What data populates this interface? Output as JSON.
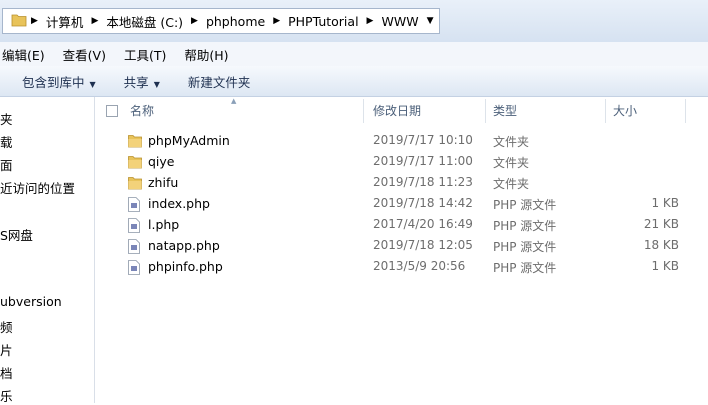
{
  "breadcrumb": [
    "计算机",
    "本地磁盘 (C:)",
    "phphome",
    "PHPTutorial",
    "WWW"
  ],
  "menu": [
    "编辑(E)",
    "查看(V)",
    "工具(T)",
    "帮助(H)"
  ],
  "toolbar": {
    "include_library": "包含到库中",
    "share": "共享",
    "new_folder": "新建文件夹"
  },
  "nav": [
    "夹",
    "载",
    "面",
    "近访问的位置",
    "S网盘",
    "ubversion",
    "频",
    "片",
    "档",
    "乐"
  ],
  "columns": {
    "name": "名称",
    "modified": "修改日期",
    "type": "类型",
    "size": "大小"
  },
  "files": [
    {
      "icon": "folder-icon",
      "name": "phpMyAdmin",
      "date": "2019/7/17 10:10",
      "type": "文件夹",
      "size": ""
    },
    {
      "icon": "folder-icon",
      "name": "qiye",
      "date": "2019/7/17 11:00",
      "type": "文件夹",
      "size": ""
    },
    {
      "icon": "folder-icon",
      "name": "zhifu",
      "date": "2019/7/18 11:23",
      "type": "文件夹",
      "size": ""
    },
    {
      "icon": "php-file-icon",
      "name": "index.php",
      "date": "2019/7/18 14:42",
      "type": "PHP 源文件",
      "size": "1 KB"
    },
    {
      "icon": "php-file-icon",
      "name": "l.php",
      "date": "2017/4/20 16:49",
      "type": "PHP 源文件",
      "size": "21 KB"
    },
    {
      "icon": "php-file-icon",
      "name": "natapp.php",
      "date": "2019/7/18 12:05",
      "type": "PHP 源文件",
      "size": "18 KB"
    },
    {
      "icon": "php-file-icon",
      "name": "phpinfo.php",
      "date": "2013/5/9 20:56",
      "type": "PHP 源文件",
      "size": "1 KB"
    }
  ]
}
